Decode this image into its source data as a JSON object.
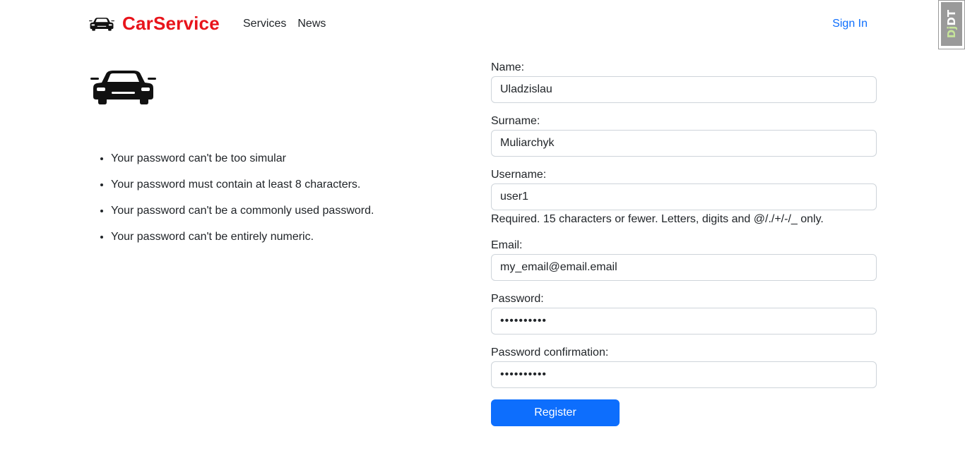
{
  "header": {
    "brand": "CarService",
    "brand_color": "#e8141b",
    "brand_icon": "car-icon",
    "nav": [
      {
        "label": "Services"
      },
      {
        "label": "News"
      }
    ],
    "sign_in": "Sign In"
  },
  "left": {
    "hero_icon": "car-icon",
    "rules": [
      "Your password can't be too simular",
      "Your password must contain at least 8 characters.",
      "Your password can't be a commonly used password.",
      "Your password can't be entirely numeric."
    ]
  },
  "form": {
    "name": {
      "label": "Name:",
      "value": "Uladzislau"
    },
    "surname": {
      "label": "Surname:",
      "value": "Muliarchyk"
    },
    "username": {
      "label": "Username:",
      "value": "user1",
      "help": "Required. 15 characters or fewer. Letters, digits and @/./+/-/_ only."
    },
    "email": {
      "label": "Email:",
      "value": "my_email@email.email"
    },
    "password": {
      "label": "Password:",
      "value": "••••••••••"
    },
    "password_confirmation": {
      "label": "Password confirmation:",
      "value": "••••••••••"
    },
    "submit": "Register",
    "accent_color": "#0d6efd"
  },
  "debug_toolbar": {
    "prefix": "Dj",
    "suffix": "DT"
  }
}
